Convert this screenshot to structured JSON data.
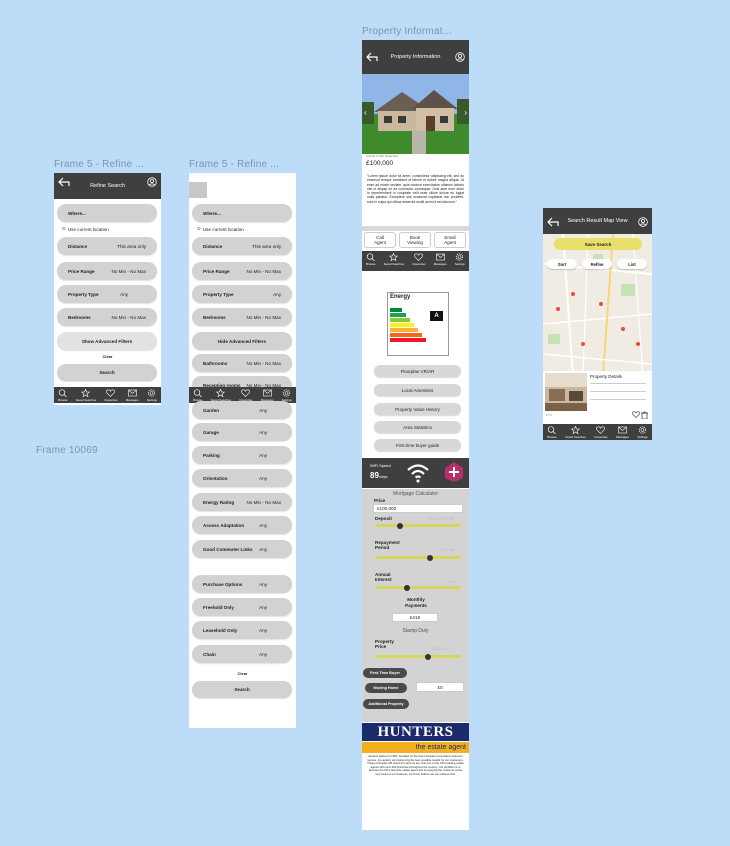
{
  "frames": {
    "f1_title": "Frame 5 - Refine ...",
    "f2_title": "Frame 5 - Refine ...",
    "f3_title": "Property Informat...",
    "f4_title": "Frame 10069"
  },
  "refine": {
    "header": "Refine Search",
    "where": "Where...",
    "use_location": "Use current location",
    "rows": [
      {
        "label": "Distance",
        "value": "This area only"
      },
      {
        "label": "Price Range",
        "value": "No Min - No Max"
      },
      {
        "label": "Property Type",
        "value": "Any"
      },
      {
        "label": "Bedrooms",
        "value": "No Min - No Max"
      }
    ],
    "show_adv": "Show Advanced Filters",
    "hide_adv": "Hide Advanced Filters",
    "clear": "Clear",
    "search": "Search",
    "adv_rows": [
      {
        "label": "Bathrooms",
        "value": "No Min - No Max"
      },
      {
        "label": "Reception rooms",
        "value": "No Min - No Max"
      },
      {
        "label": "Garden",
        "value": "Any"
      },
      {
        "label": "Garage",
        "value": "Any"
      },
      {
        "label": "Parking",
        "value": "Any"
      },
      {
        "label": "Orientation",
        "value": "Any"
      },
      {
        "label": "Energy Rating",
        "value": "No Min - No Max"
      },
      {
        "label": "Access Adaptation",
        "value": "Any"
      },
      {
        "label": "Good Commuter Links",
        "value": "Any"
      }
    ],
    "extra_rows": [
      {
        "label": "Purchase Options",
        "value": "Any"
      },
      {
        "label": "Freehold Only",
        "value": "Any"
      },
      {
        "label": "Leasehold Only",
        "value": "Any"
      },
      {
        "label": "Chain",
        "value": "Any"
      }
    ]
  },
  "nav": [
    "Browse",
    "Saved Searches",
    "Favourites",
    "Messages",
    "Settings"
  ],
  "property": {
    "header": "Property Information",
    "meta": "3 beds  2 bath  Detached",
    "price": "£100,000",
    "desc": "\"Lorem ipsum dolor sit amet, consectetur adipiscing elit, sed do eiusmod tempor incididunt ut labore et dolore magna aliqua. Ut enim ad minim veniam, quis nostrud exercitation ullamco laboris nisi ut aliquip ex ea commodo consequat. Duis aute irure dolor in reprehenderit in voluptate velit esse cillum dolore eu fugiat nulla pariatur. Excepteur sint occaecat cupidatat non proident, sunt in culpa qui officia deserunt mollit anim id est laborum.\"",
    "call": "Call Agent",
    "book": "Book Viewing",
    "email": "Email Agent",
    "energy_title": "Energy",
    "energy_rating": "A",
    "buttons": [
      "Floorplan VR/AR",
      "Local Amenities",
      "Property Value History",
      "Area Statistics",
      "First time buyer guide"
    ],
    "wifi_label": "WiFi Speed",
    "wifi_value": "89",
    "wifi_unit": "mbps",
    "mortgage_title": "Mortgage Calculator",
    "price_label": "Price",
    "price_value": "£100,000",
    "deposit": "Deposit",
    "deposit_hint": "£10,000 (10%)",
    "repay": "Repayment Period",
    "repay_hint": "25 Year",
    "annual": "Annual Interest",
    "annual_hint": "3.5%",
    "monthly": "Monthly Payments",
    "monthly_value": "£418",
    "stamp": "Stamp Duty",
    "prop_price": "Property Price",
    "prop_hint": "£100,000",
    "ftb": "First Time Buyer",
    "moving": "Moving Home",
    "addl": "Additional Property",
    "stamp_value": "£0",
    "agent_name": "HUNTERS",
    "agent_tag": "the estate agent",
    "agent_text": "Hunters started in 1992, founded on the first principles of excellent customer service, pro-activity and delivering the best possible results for our customers. These principles still stand firm and we are now one of the UK's leading estate agents with over 200 branches throughout the country. Our ambition is to become the UK's favourite estate agent and by keeping the customer at the very heart of our business, we firmly believe we can achieve this."
  },
  "map": {
    "header": "Search Result Map View",
    "save": "Save Search",
    "sort": "Sort",
    "refine": "Refine",
    "list": "List",
    "details": "Property Details"
  },
  "colors": {
    "accent": "#e8e06a",
    "header": "#3f3f3f",
    "agent_blue": "#1a2a6b",
    "agent_yellow": "#f2b01e"
  }
}
